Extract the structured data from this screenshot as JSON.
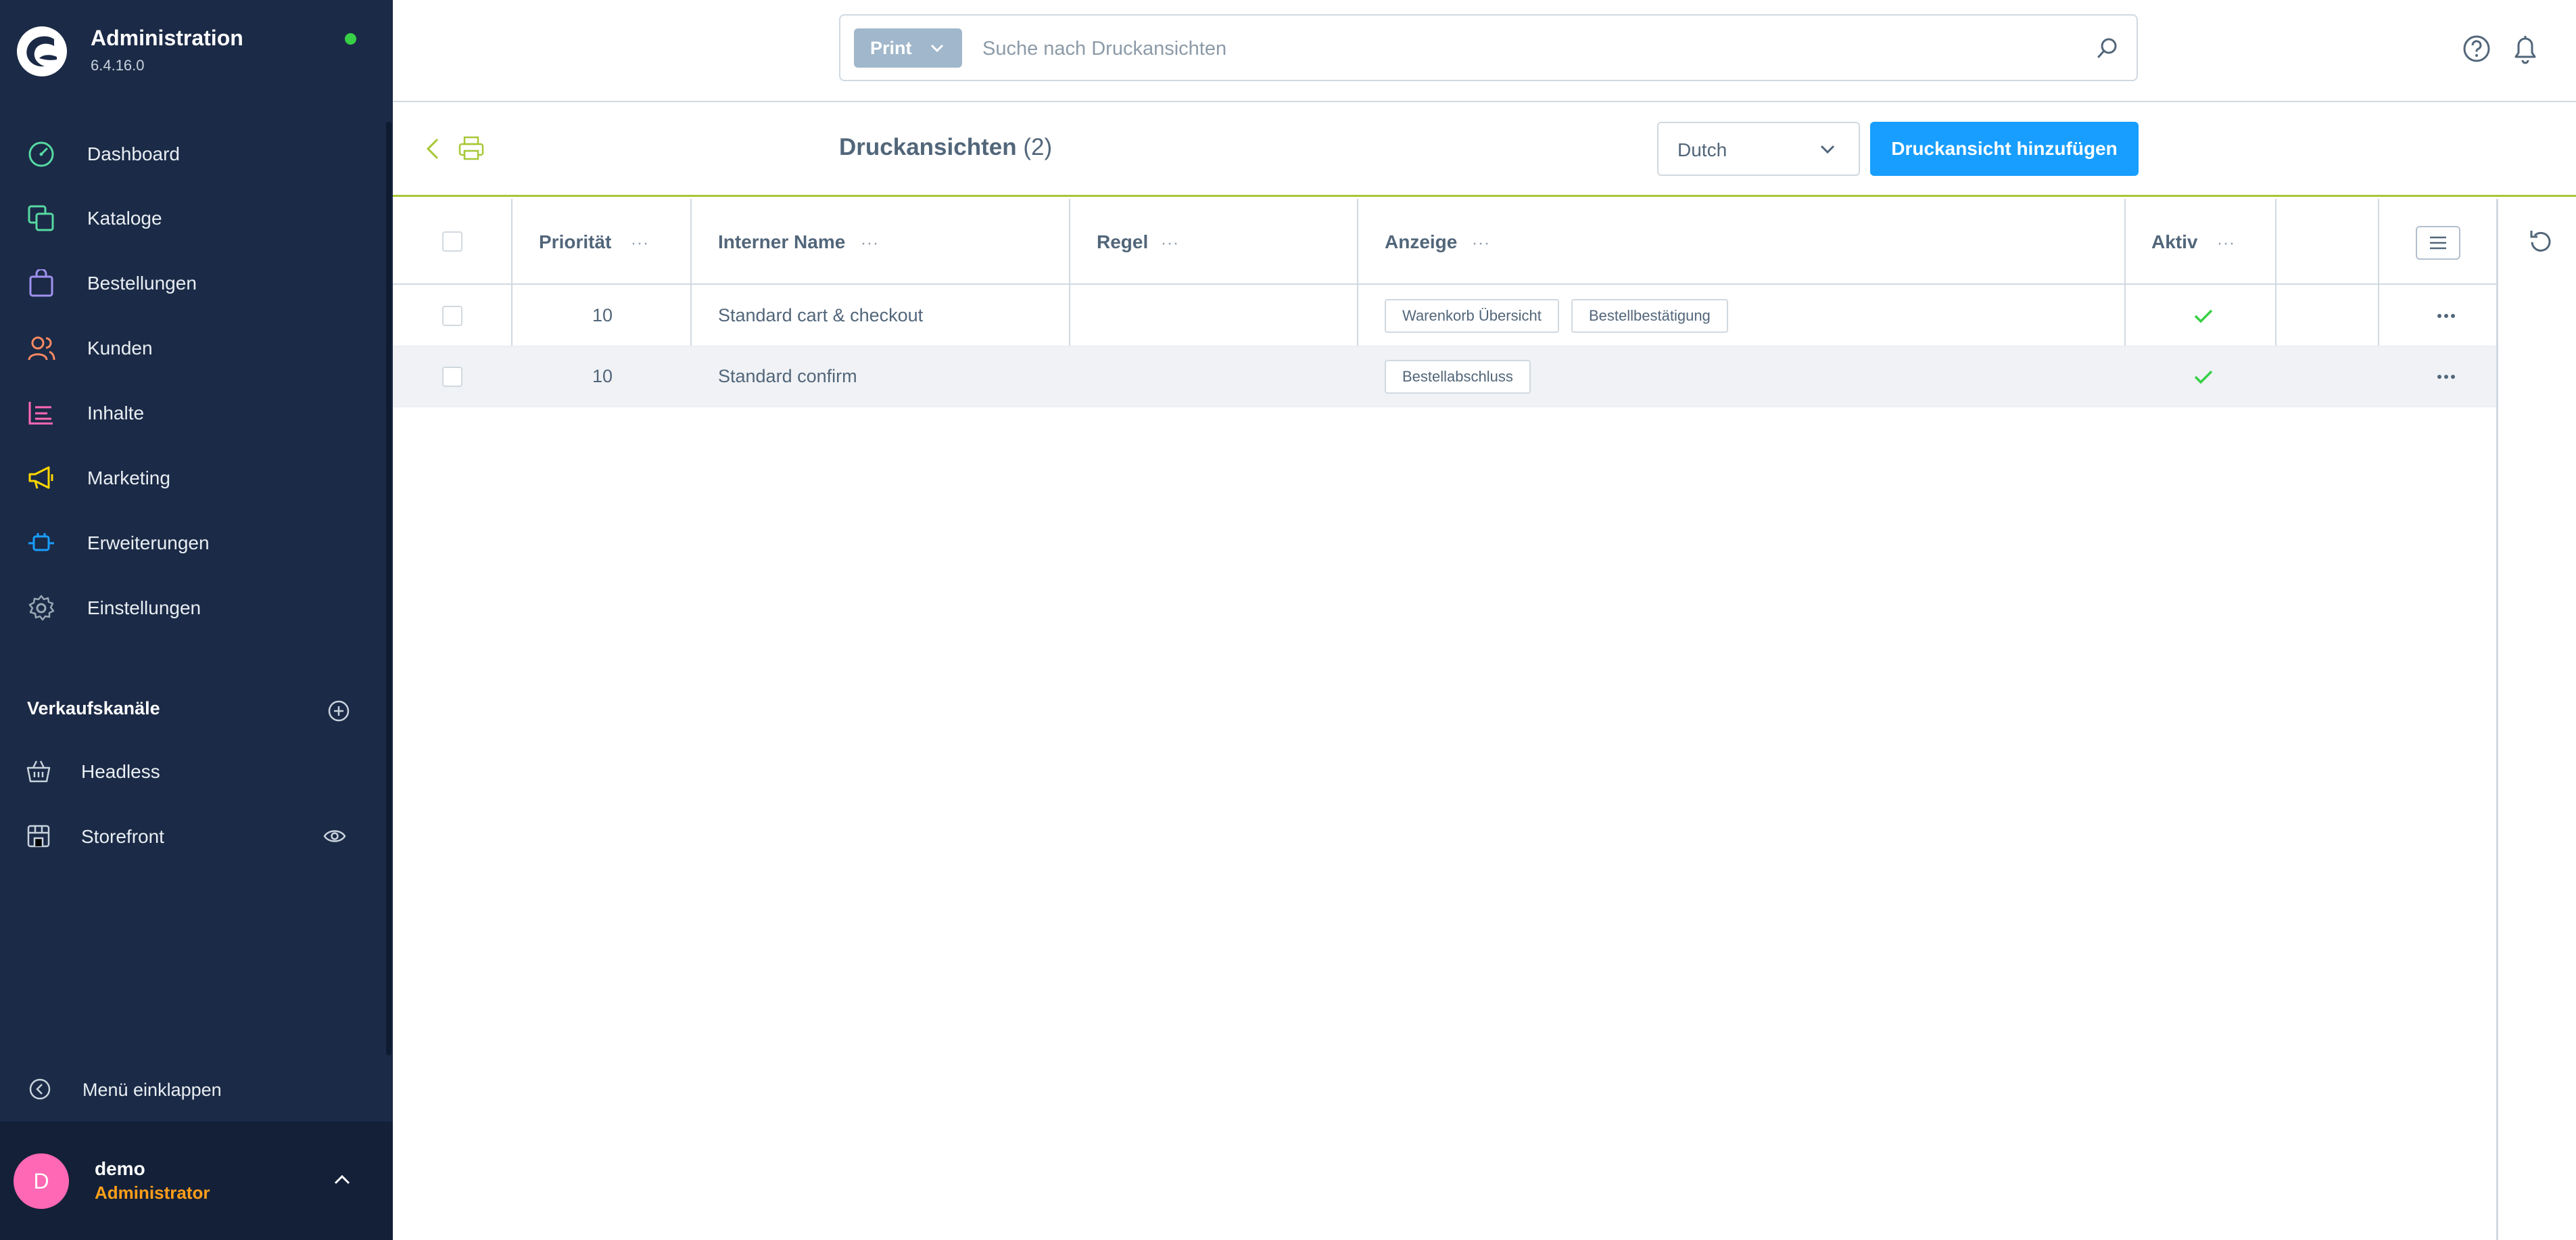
{
  "app": {
    "title": "Administration",
    "version": "6.4.16.0"
  },
  "sidebar": {
    "items": [
      {
        "label": "Dashboard",
        "icon": "dashboard-icon",
        "color": "#57d9a3"
      },
      {
        "label": "Kataloge",
        "icon": "catalog-icon",
        "color": "#57d9a3"
      },
      {
        "label": "Bestellungen",
        "icon": "orders-icon",
        "color": "#a092f0"
      },
      {
        "label": "Kunden",
        "icon": "customers-icon",
        "color": "#f88962"
      },
      {
        "label": "Inhalte",
        "icon": "content-icon",
        "color": "#ff68b4"
      },
      {
        "label": "Marketing",
        "icon": "marketing-icon",
        "color": "#ffd700"
      },
      {
        "label": "Erweiterungen",
        "icon": "extensions-icon",
        "color": "#189eff"
      },
      {
        "label": "Einstellungen",
        "icon": "settings-icon",
        "color": "#9aa8b5"
      }
    ],
    "sales_channels_title": "Verkaufskanäle",
    "sales_channels": [
      {
        "label": "Headless",
        "icon": "basket-icon"
      },
      {
        "label": "Storefront",
        "icon": "storefront-icon"
      }
    ],
    "collapse_label": "Menü einklappen"
  },
  "user": {
    "initial": "D",
    "name": "demo",
    "role": "Administrator"
  },
  "search": {
    "type_label": "Print",
    "placeholder": "Suche nach Druckansichten"
  },
  "toolbar": {
    "title": "Druckansichten",
    "count": "(2)",
    "language": "Dutch",
    "add_button": "Druckansicht hinzufügen"
  },
  "grid": {
    "columns": [
      "Priorität",
      "Interner Name",
      "Regel",
      "Anzeige",
      "Aktiv"
    ],
    "rows": [
      {
        "priority": "10",
        "name": "Standard cart & checkout",
        "rule": "",
        "display": [
          "Warenkorb Übersicht",
          "Bestellbestätigung"
        ],
        "active": true
      },
      {
        "priority": "10",
        "name": "Standard confirm",
        "rule": "",
        "display": [
          "Bestellabschluss"
        ],
        "active": true
      }
    ]
  },
  "colors": {
    "sidebar_bg": "#1b2a46",
    "primary": "#189eff",
    "accent_green": "#a6c836",
    "status_online": "#37d046",
    "check": "#37d046",
    "avatar": "#ff68b4",
    "role": "#ff9f1a"
  }
}
